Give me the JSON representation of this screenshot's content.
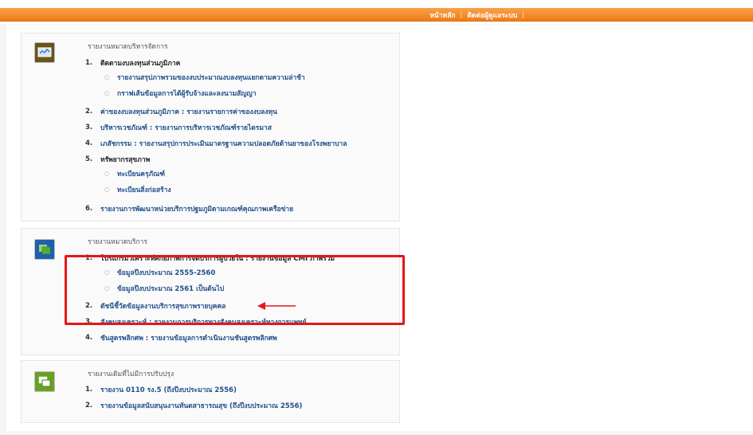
{
  "topnav": {
    "home": "หน้าหลัก",
    "contact": "ติดต่อผู้ดูแลระบบ"
  },
  "panel1": {
    "title": "รายงานหมวดบริหารจัดการ",
    "items": [
      {
        "num": "1.",
        "label": "ติดตามงบลงทุนส่วนภูมิภาค"
      },
      {
        "num": "2.",
        "label": "ค่าของงบลงทุนส่วนภูมิภาค : รายงานรายการค่าของงบลงทุน"
      },
      {
        "num": "3.",
        "label": "บริหารเวชภัณฑ์ : รายงานการบริหารเวชภัณฑ์รายไตรมาส"
      },
      {
        "num": "4.",
        "label": "เภสัชกรรม : รายงานสรุปการประเมินมาตรฐานความปลอดภัยด้านยาของโรงพยาบาล"
      },
      {
        "num": "5.",
        "label": "ทรัพยากรสุขภาพ"
      },
      {
        "num": "6.",
        "label": "รายงานการพัฒนาหน่วยบริการปฐมภูมิตามเกณฑ์คุณภาพเครือข่าย"
      }
    ],
    "sub1": [
      "รายงานสรุปภาพรวมของงบประมาณงบลงทุนแยกตามความล่าช้า",
      "กราฟเส้นข้อมูลการได้ผู้รับจ้างและลงนามสัญญา"
    ],
    "sub5": [
      "ทะเบียนครุภัณฑ์",
      "ทะเบียนสิ่งก่อสร้าง"
    ]
  },
  "panel2": {
    "title": "รายงานหมวดบริการ",
    "items": [
      {
        "num": "1.",
        "label": "โปรแกรมวิเคราะห์ศักยภาพการจัดบริการผู้ป่วยใน : รายงานข้อมูล CMI ภาพรวม"
      },
      {
        "num": "2.",
        "label": "ดัชนีชี้วัดข้อมูลงานบริการสุขภาพรายบุคคล"
      },
      {
        "num": "3.",
        "label": "สังคมสงเคราะห์ : รายงานการบริการทางสังคมสงเคราะห์ทางการแพทย์"
      },
      {
        "num": "4.",
        "label": "ชันสูตรพลิกศพ : รายงานข้อมูลการดำเนินงานชันสูตรพลิกศพ"
      }
    ],
    "sub1": [
      "ข้อมูลปีงบประมาณ 2555-2560",
      "ข้อมูลปีงบประมาณ 2561 เป็นต้นไป"
    ]
  },
  "panel3": {
    "title": "รายงานเดิมที่ไม่มีการปรับปรุง",
    "items": [
      {
        "num": "1.",
        "label": "รายงาน 0110 รง.5 (ถึงปีงบประมาณ 2556)"
      },
      {
        "num": "2.",
        "label": "รายงานข้อมูลสนับสนุนงานทันตสาธารณสุข (ถึงปีงบประมาณ 2556)"
      }
    ]
  },
  "bullet_glyph": "○",
  "colors": {
    "topbar": "#ef7d17",
    "link": "#1f4f8a",
    "highlight": "#e61616"
  }
}
